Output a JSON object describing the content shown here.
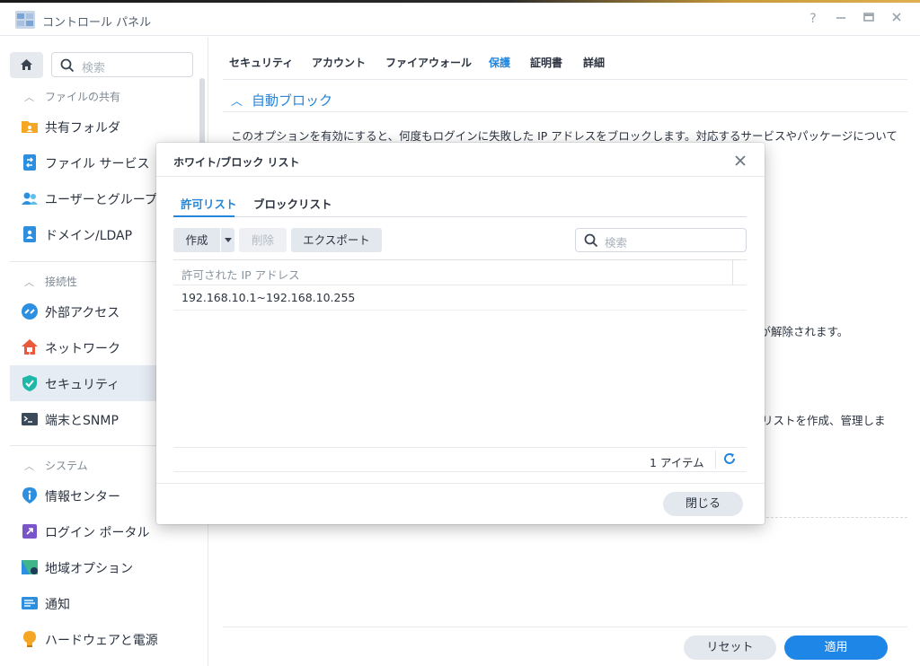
{
  "window": {
    "title": "コントロール パネル",
    "controls": [
      "help-icon",
      "minimize-icon",
      "maximize-icon",
      "close-icon"
    ]
  },
  "sidebar": {
    "search_placeholder": "検索",
    "sections": [
      {
        "title": "ファイルの共有",
        "items": [
          {
            "label": "共有フォルダ",
            "icon": "shared-folder-icon"
          },
          {
            "label": "ファイル サービス",
            "icon": "file-services-icon"
          },
          {
            "label": "ユーザーとグループ",
            "icon": "users-groups-icon"
          },
          {
            "label": "ドメイン/LDAP",
            "icon": "domain-ldap-icon"
          }
        ]
      },
      {
        "title": "接続性",
        "items": [
          {
            "label": "外部アクセス",
            "icon": "external-access-icon"
          },
          {
            "label": "ネットワーク",
            "icon": "network-icon"
          },
          {
            "label": "セキュリティ",
            "icon": "security-shield-icon",
            "active": true
          },
          {
            "label": "端末とSNMP",
            "icon": "terminal-icon"
          }
        ]
      },
      {
        "title": "システム",
        "items": [
          {
            "label": "情報センター",
            "icon": "info-center-icon"
          },
          {
            "label": "ログイン ポータル",
            "icon": "login-portal-icon"
          },
          {
            "label": "地域オプション",
            "icon": "regional-options-icon"
          },
          {
            "label": "通知",
            "icon": "notification-icon"
          },
          {
            "label": "ハードウェアと電源",
            "icon": "hardware-power-icon"
          }
        ]
      }
    ]
  },
  "main": {
    "tabs": [
      {
        "label": "セキュリティ"
      },
      {
        "label": "アカウント"
      },
      {
        "label": "ファイアウォール"
      },
      {
        "label": "保護",
        "active": true
      },
      {
        "label": "証明書"
      },
      {
        "label": "詳細"
      }
    ],
    "section_title": "自動ブロック",
    "paragraphs": [
      "このオプションを有効にすると、何度もログインに失敗した IP アドレスをブロックします。対応するサービスやパッケージについて",
      "クが解除されます。",
      "リストを作成、管理しま"
    ],
    "buttons": {
      "reset": "リセット",
      "apply": "適用"
    }
  },
  "dialog": {
    "title": "ホワイト/ブロック リスト",
    "tabs": [
      {
        "label": "許可リスト",
        "active": true
      },
      {
        "label": "ブロックリスト"
      }
    ],
    "toolbar": {
      "create": "作成",
      "delete": "削除",
      "export": "エクスポート",
      "search_placeholder": "検索"
    },
    "grid": {
      "column": "許可された IP アドレス",
      "rows": [
        "192.168.10.1~192.168.10.255"
      ],
      "item_count": "1 アイテム"
    },
    "close_label": "閉じる"
  },
  "colors": {
    "accent": "#2585d9",
    "apply_button": "#1e86e6",
    "active_item_bg": "#e6ecf4"
  }
}
